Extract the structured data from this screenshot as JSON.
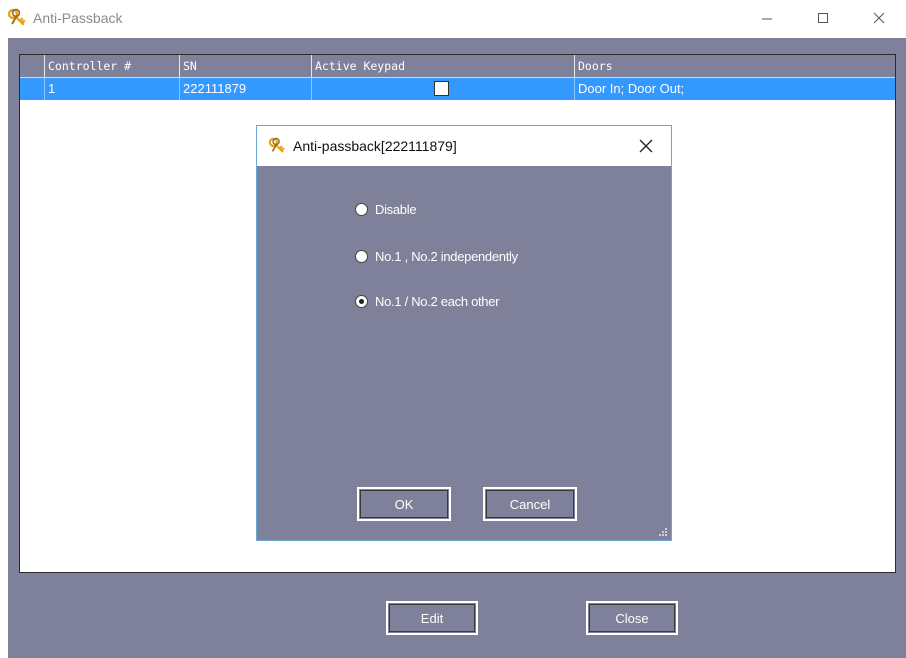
{
  "window": {
    "title": "Anti-Passback",
    "icon": "keys-icon"
  },
  "grid": {
    "columns": [
      "Controller #",
      "SN",
      "Active Keypad",
      "Doors"
    ],
    "rows": [
      {
        "controller": "1",
        "sn": "222111879",
        "active_keypad": false,
        "doors": "Door In;  Door Out;",
        "selected": true
      }
    ]
  },
  "buttons": {
    "edit": "Edit",
    "close": "Close"
  },
  "dialog": {
    "title": "Anti-passback[222111879]",
    "options": [
      {
        "label": "Disable",
        "checked": false
      },
      {
        "label": "No.1 , No.2 independently",
        "checked": false
      },
      {
        "label": "No.1 / No.2 each other",
        "checked": true
      }
    ],
    "ok": "OK",
    "cancel": "Cancel"
  },
  "colors": {
    "panel": "#7e8199",
    "selection": "#3399ff"
  }
}
